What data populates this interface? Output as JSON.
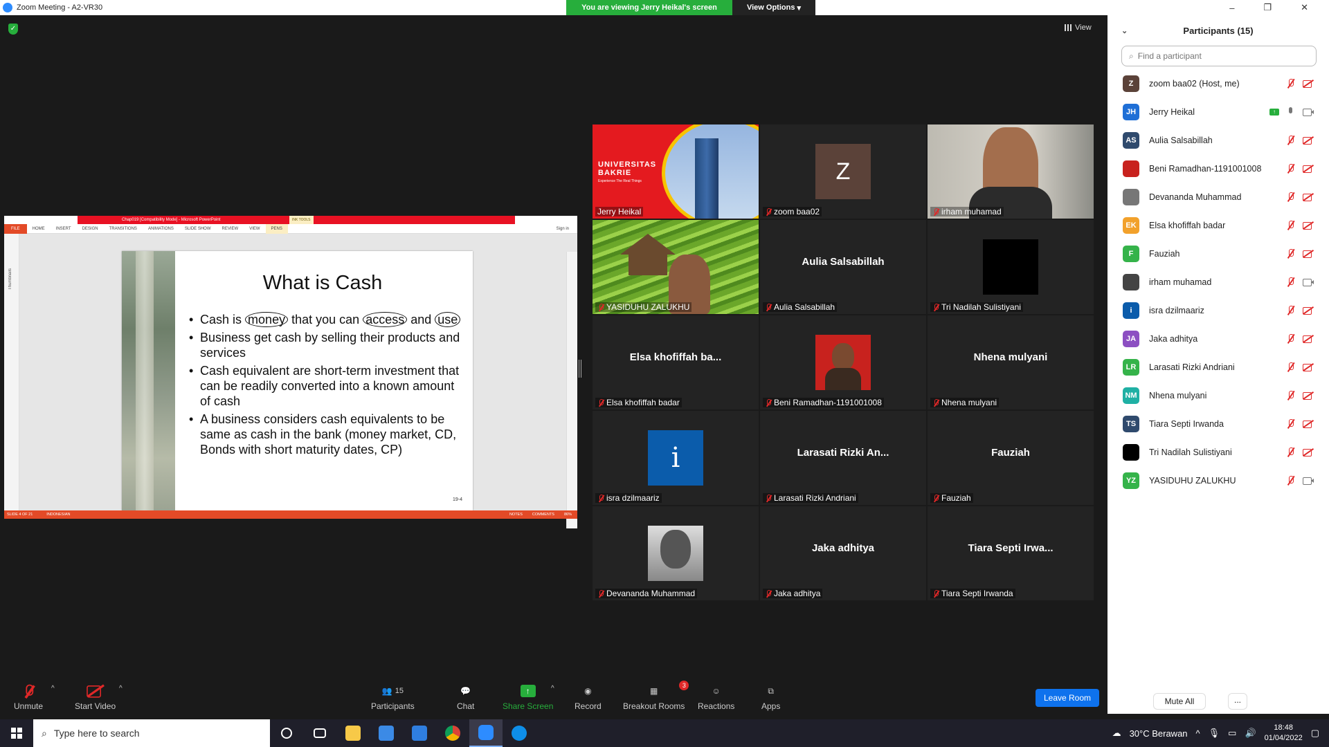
{
  "window": {
    "title": "Zoom Meeting - A2-VR30",
    "viewing_banner": "You are viewing Jerry Heikal's screen",
    "view_options": "View Options",
    "view_button": "View",
    "controls": [
      "–",
      "❐",
      "✕"
    ]
  },
  "shared_screen": {
    "ppt_title": "Chap019 [Compatibility Mode] - Microsoft PowerPoint",
    "ink_tools": "INK TOOLS",
    "ribbon_tabs": [
      "FILE",
      "HOME",
      "INSERT",
      "DESIGN",
      "TRANSITIONS",
      "ANIMATIONS",
      "SLIDE SHOW",
      "REVIEW",
      "VIEW",
      "PENS"
    ],
    "sign_in": "Sign in",
    "thumbnails_label": "Thumbnails",
    "slide_title": "What is Cash",
    "bullets": {
      "b1_pre": "Cash is",
      "b1_money": "money",
      "b1_mid": "that you can",
      "b1_access": "access",
      "b1_and": "and",
      "b1_use": "use",
      "b2": "Business get cash by selling their products and services",
      "b3": "Cash equivalent are short-term investment that can be readily converted into a known amount of cash",
      "b4": "A business considers cash equivalents to be same as cash in the bank (money market, CD, Bonds with short maturity dates, CP)"
    },
    "page_number": "19-4",
    "status": {
      "slide": "SLIDE 4 OF 21",
      "language": "INDONESIAN",
      "notes": "NOTES",
      "comments": "COMMENTS",
      "zoom": "86%"
    }
  },
  "gallery": {
    "jerry": {
      "name": "Jerry Heikal",
      "uni_line1": "UNIVERSITAS",
      "uni_line2": "BAKRIE",
      "uni_tagline": "Experience The Real Things"
    },
    "zoom": {
      "name": "zoom baa02",
      "initial": "Z"
    },
    "irham": {
      "name": "irham muhamad"
    },
    "yasiduhu": {
      "name": "YASIDUHU ZALUKHU"
    },
    "aulia": {
      "name": "Aulia Salsabillah",
      "big": "Aulia Salsabillah"
    },
    "tri": {
      "name": "Tri Nadilah Sulistiyani"
    },
    "elsa": {
      "name": "Elsa khofiffah badar",
      "big": "Elsa khofiffah ba..."
    },
    "beni": {
      "name": "Beni Ramadhan-1191001008"
    },
    "nhena": {
      "name": "Nhena mulyani",
      "big": "Nhena mulyani"
    },
    "isra": {
      "name": "isra dzilmaariz",
      "initial": "i"
    },
    "larasati": {
      "name": "Larasati Rizki Andriani",
      "big": "Larasati Rizki An..."
    },
    "fauziah": {
      "name": "Fauziah",
      "big": "Fauziah"
    },
    "devananda": {
      "name": "Devananda Muhammad"
    },
    "jaka": {
      "name": "Jaka adhitya",
      "big": "Jaka adhitya"
    },
    "tiara": {
      "name": "Tiara Septi Irwanda",
      "big": "Tiara Septi Irwa..."
    }
  },
  "toolbar": {
    "unmute": "Unmute",
    "start_video": "Start Video",
    "participants": "Participants",
    "participants_count": "15",
    "chat": "Chat",
    "share_screen": "Share Screen",
    "record": "Record",
    "breakout_rooms": "Breakout Rooms",
    "breakout_badge": "3",
    "reactions": "Reactions",
    "apps": "Apps",
    "leave_room": "Leave Room"
  },
  "panel": {
    "title": "Participants (15)",
    "search_placeholder": "Find a participant",
    "participants": [
      {
        "initials": "Z",
        "name": "zoom baa02 (Host, me)",
        "color": "#5b4239"
      },
      {
        "initials": "JH",
        "name": "Jerry Heikal",
        "color": "#1f6fd6"
      },
      {
        "initials": "AS",
        "name": "Aulia Salsabillah",
        "color": "#2f4a6d"
      },
      {
        "initials": "",
        "name": "Beni Ramadhan-1191001008",
        "color": "#c8221e"
      },
      {
        "initials": "",
        "name": "Devananda Muhammad",
        "color": "#777777"
      },
      {
        "initials": "EK",
        "name": "Elsa khofiffah badar",
        "color": "#f2a12b"
      },
      {
        "initials": "F",
        "name": "Fauziah",
        "color": "#35b34a"
      },
      {
        "initials": "",
        "name": "irham muhamad",
        "color": "#444444"
      },
      {
        "initials": "i",
        "name": "isra dzilmaariz",
        "color": "#0b5cab"
      },
      {
        "initials": "JA",
        "name": "Jaka adhitya",
        "color": "#8c4fc2"
      },
      {
        "initials": "LR",
        "name": "Larasati Rizki Andriani",
        "color": "#35b34a"
      },
      {
        "initials": "NM",
        "name": "Nhena mulyani",
        "color": "#1fb0a4"
      },
      {
        "initials": "TS",
        "name": "Tiara Septi Irwanda",
        "color": "#2f4a6d"
      },
      {
        "initials": "",
        "name": "Tri Nadilah Sulistiyani",
        "color": "#000000"
      },
      {
        "initials": "YZ",
        "name": "YASIDUHU ZALUKHU",
        "color": "#35b34a"
      }
    ],
    "mute_all": "Mute All",
    "more": "..."
  },
  "taskbar": {
    "search_placeholder": "Type here to search",
    "weather": "30°C  Berawan",
    "time": "18:48",
    "date": "01/04/2022"
  }
}
